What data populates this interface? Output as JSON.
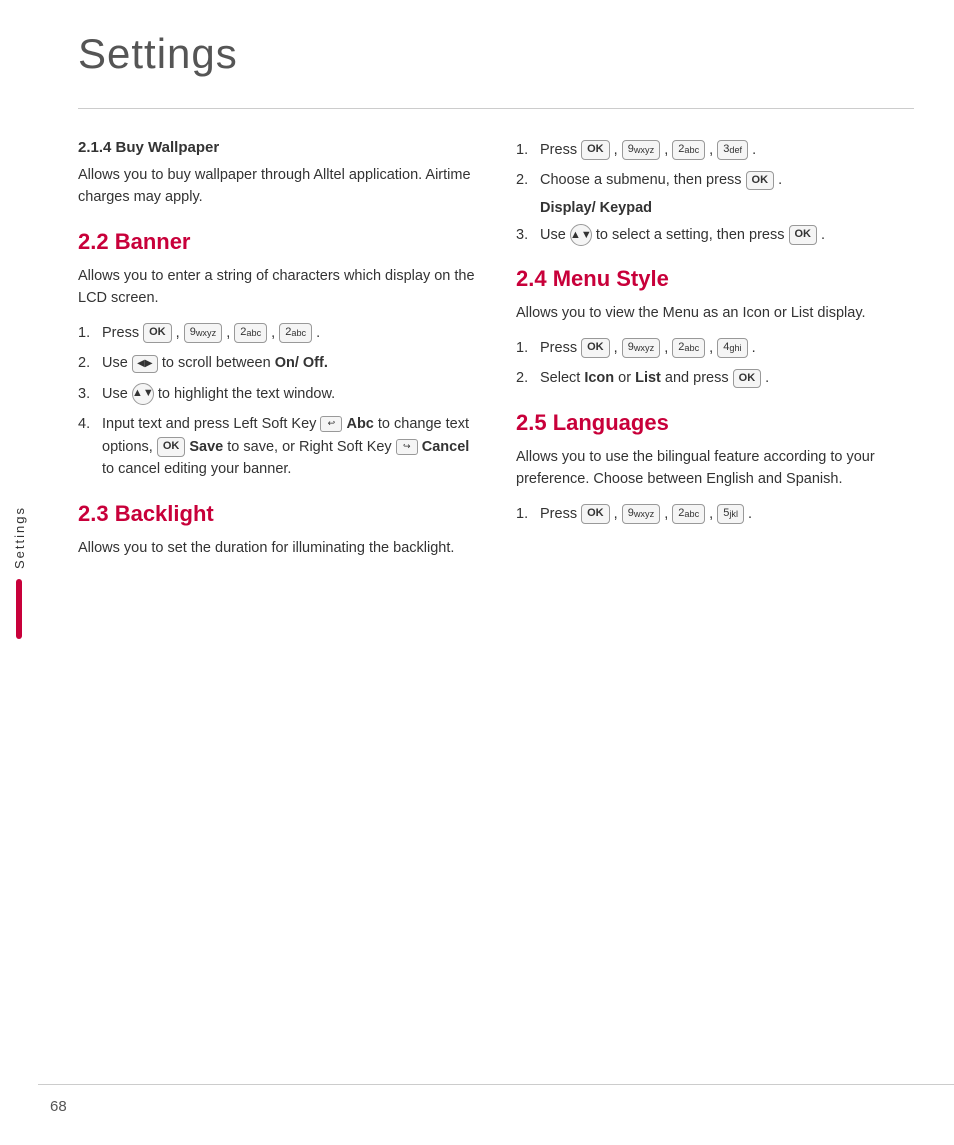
{
  "page": {
    "title": "Settings",
    "number": "68"
  },
  "sidebar": {
    "label": "Settings"
  },
  "left_col": {
    "section_214": {
      "title": "2.1.4 Buy Wallpaper",
      "body": "Allows you to buy wallpaper through Alltel application. Airtime charges may apply."
    },
    "section_22": {
      "title": "2.2 Banner",
      "body": "Allows you to enter a string of characters which display on the LCD screen.",
      "steps": [
        {
          "num": "1.",
          "text": "Press"
        },
        {
          "num": "2.",
          "prefix": "Use",
          "suffix": "to scroll between",
          "bold": "On/ Off."
        },
        {
          "num": "3.",
          "prefix": "Use",
          "suffix": "to highlight the text window."
        },
        {
          "num": "4.",
          "text": "Input text and press Left Soft Key",
          "bold1": "Abc",
          "mid": "to change text options,",
          "bold2": "Save",
          "mid2": "to save, or Right Soft Key",
          "bold3": "Cancel",
          "end": "to cancel editing your banner."
        }
      ]
    },
    "section_23": {
      "title": "2.3 Backlight",
      "body": "Allows you to set the duration for illuminating the backlight."
    }
  },
  "right_col": {
    "step_r1": {
      "num": "1.",
      "text": "Press"
    },
    "step_r2": {
      "num": "2.",
      "text": "Choose a submenu, then press"
    },
    "display_keypad": "Display/ Keypad",
    "step_r3": {
      "num": "3.",
      "text": "Use",
      "suffix": "to select a setting, then press"
    },
    "section_24": {
      "title": "2.4 Menu Style",
      "body": "Allows you to view the Menu as an Icon or List display."
    },
    "step_24_1": {
      "num": "1.",
      "text": "Press"
    },
    "step_24_2": {
      "num": "2.",
      "text": "Select",
      "bold1": "Icon",
      "mid": "or",
      "bold2": "List",
      "suffix": "and press"
    },
    "section_25": {
      "title": "2.5 Languages",
      "body": "Allows you to use the bilingual feature according to your preference. Choose between English and Spanish."
    },
    "step_25_1": {
      "num": "1.",
      "text": "Press"
    }
  },
  "keys": {
    "ok": "OK",
    "9wxyz": "9 wxyz",
    "2abc": "2 abc",
    "3def": "3 def",
    "4ghi": "4 ghi",
    "5jkl": "5 jkl"
  }
}
